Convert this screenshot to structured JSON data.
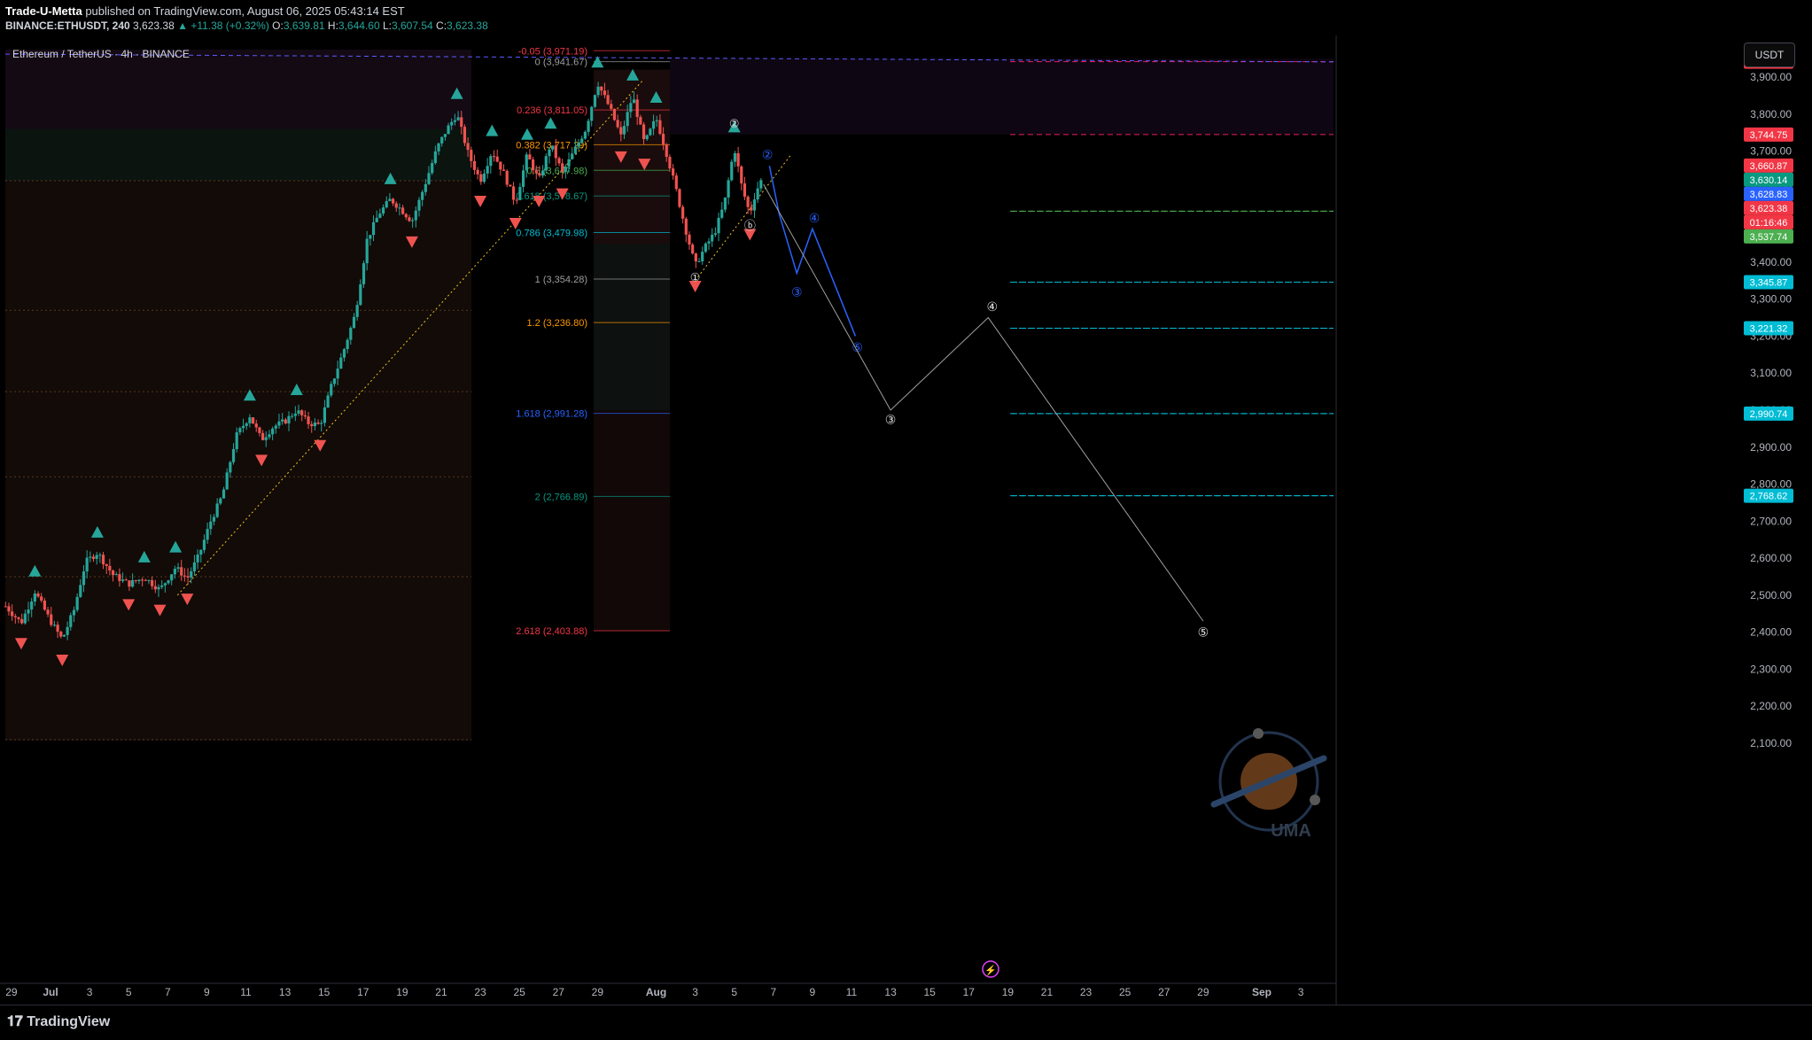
{
  "header": {
    "author": "Trade-U-Metta",
    "published": "published on TradingView.com, August 06, 2025 05:43:14 EST",
    "symbol": "BINANCE:ETHUSDT, 240",
    "last": "3,623.38",
    "change": "▲ +11.38 (+0.32%)",
    "open_label": "O:",
    "open": "3,639.81",
    "high_label": "H:",
    "high": "3,644.60",
    "low_label": "L:",
    "low": "3,607.54",
    "close_label": "C:",
    "close": "3,623.38"
  },
  "symbol_title": "Ethereum / TetherUS · 4h · BINANCE",
  "currency_button": "USDT",
  "footer": {
    "brand": "TradingView"
  },
  "colors": {
    "bull": "#26a69a",
    "bear": "#ef5350",
    "wave_blue": "#2962ff",
    "wave_white": "#e0e0e0",
    "level_cyan": "#00bcd4",
    "level_green": "#4caf50",
    "fib_orange": "#ff9800",
    "trendline": "#f0c419"
  },
  "chart_data": {
    "type": "candlestick",
    "y_axis": {
      "min": 2080,
      "max": 4000,
      "scale": "linear",
      "ticks": [
        "3,900.00",
        "3,800.00",
        "3,700.00",
        "3,600.00",
        "3,500.00",
        "3,400.00",
        "3,300.00",
        "3,200.00",
        "3,100.00",
        "3,000.00",
        "2,900.00",
        "2,800.00",
        "2,700.00",
        "2,600.00",
        "2,500.00",
        "2,400.00",
        "2,300.00",
        "2,200.00",
        "2,100.00"
      ],
      "tick_values": [
        3900,
        3800,
        3700,
        3600,
        3500,
        3400,
        3300,
        3200,
        3100,
        3000,
        2900,
        2800,
        2700,
        2600,
        2500,
        2400,
        2300,
        2200,
        2100
      ]
    },
    "x_axis": {
      "ticks": [
        "29",
        "Jul",
        "3",
        "5",
        "7",
        "9",
        "11",
        "13",
        "15",
        "17",
        "19",
        "21",
        "23",
        "25",
        "27",
        "29",
        "Aug",
        "3",
        "5",
        "7",
        "9",
        "11",
        "13",
        "15",
        "17",
        "19",
        "21",
        "23",
        "25",
        "27",
        "29",
        "Sep",
        "3"
      ],
      "tick_days": [
        -2,
        0,
        2,
        4,
        6,
        8,
        10,
        12,
        14,
        16,
        18,
        20,
        22,
        24,
        26,
        28,
        31,
        33,
        35,
        37,
        39,
        41,
        43,
        45,
        47,
        49,
        51,
        53,
        55,
        57,
        59,
        62,
        64
      ],
      "bold_ticks": [
        "Jul",
        "Aug",
        "Sep"
      ]
    },
    "price_path": [
      {
        "day": -2.3,
        "price": 2470
      },
      {
        "day": -1.5,
        "price": 2425
      },
      {
        "day": -0.8,
        "price": 2510
      },
      {
        "day": 0,
        "price": 2430
      },
      {
        "day": 0.6,
        "price": 2380
      },
      {
        "day": 1.2,
        "price": 2460
      },
      {
        "day": 1.8,
        "price": 2590
      },
      {
        "day": 2.4,
        "price": 2615
      },
      {
        "day": 3.2,
        "price": 2555
      },
      {
        "day": 4,
        "price": 2530
      },
      {
        "day": 4.8,
        "price": 2548
      },
      {
        "day": 5.6,
        "price": 2515
      },
      {
        "day": 6.4,
        "price": 2575
      },
      {
        "day": 7,
        "price": 2545
      },
      {
        "day": 7.6,
        "price": 2608
      },
      {
        "day": 8.2,
        "price": 2700
      },
      {
        "day": 8.8,
        "price": 2770
      },
      {
        "day": 9.5,
        "price": 2930
      },
      {
        "day": 10.2,
        "price": 2985
      },
      {
        "day": 10.8,
        "price": 2920
      },
      {
        "day": 11.4,
        "price": 2955
      },
      {
        "day": 12,
        "price": 2970
      },
      {
        "day": 12.6,
        "price": 3000
      },
      {
        "day": 13.2,
        "price": 2965
      },
      {
        "day": 13.8,
        "price": 2960
      },
      {
        "day": 14.4,
        "price": 3070
      },
      {
        "day": 15,
        "price": 3160
      },
      {
        "day": 15.6,
        "price": 3260
      },
      {
        "day": 16.2,
        "price": 3460
      },
      {
        "day": 16.8,
        "price": 3530
      },
      {
        "day": 17.4,
        "price": 3570
      },
      {
        "day": 17.9,
        "price": 3545
      },
      {
        "day": 18.5,
        "price": 3510
      },
      {
        "day": 19.2,
        "price": 3615
      },
      {
        "day": 19.8,
        "price": 3710
      },
      {
        "day": 20.3,
        "price": 3760
      },
      {
        "day": 20.8,
        "price": 3800
      },
      {
        "day": 21.4,
        "price": 3690
      },
      {
        "day": 22,
        "price": 3620
      },
      {
        "day": 22.6,
        "price": 3700
      },
      {
        "day": 23.2,
        "price": 3640
      },
      {
        "day": 23.8,
        "price": 3560
      },
      {
        "day": 24.4,
        "price": 3690
      },
      {
        "day": 25,
        "price": 3620
      },
      {
        "day": 25.6,
        "price": 3720
      },
      {
        "day": 26.2,
        "price": 3640
      },
      {
        "day": 26.8,
        "price": 3700
      },
      {
        "day": 27.4,
        "price": 3760
      },
      {
        "day": 28,
        "price": 3885
      },
      {
        "day": 28.6,
        "price": 3820
      },
      {
        "day": 29.2,
        "price": 3740
      },
      {
        "day": 29.8,
        "price": 3850
      },
      {
        "day": 30.4,
        "price": 3720
      },
      {
        "day": 31,
        "price": 3790
      },
      {
        "day": 31.5,
        "price": 3700
      },
      {
        "day": 32,
        "price": 3600
      },
      {
        "day": 32.5,
        "price": 3490
      },
      {
        "day": 33,
        "price": 3390
      },
      {
        "day": 33.5,
        "price": 3440
      },
      {
        "day": 34,
        "price": 3480
      },
      {
        "day": 34.5,
        "price": 3560
      },
      {
        "day": 35,
        "price": 3710
      },
      {
        "day": 35.4,
        "price": 3600
      },
      {
        "day": 35.8,
        "price": 3530
      },
      {
        "day": 36.1,
        "price": 3590
      },
      {
        "day": 36.4,
        "price": 3623
      }
    ],
    "price_labels": [
      {
        "text": "3,941.67",
        "price": 3941.67,
        "color": "#f23645"
      },
      {
        "text": "3,744.75",
        "price": 3744.75,
        "color": "#f23645"
      },
      {
        "text": "3,660.87",
        "price": 3660.87,
        "color": "#f23645"
      },
      {
        "text": "3,630.14",
        "price": 3630.14,
        "color": "#089981"
      },
      {
        "text": "3,628.83",
        "price": 3628.83,
        "color": "#2962ff"
      },
      {
        "text": "3,623.38",
        "price": 3623.38,
        "color": "#f23645"
      },
      {
        "text": "01:16:46",
        "price": 3600,
        "color": "#f23645"
      },
      {
        "text": "3,537.74",
        "price": 3537.74,
        "color": "#4caf50"
      },
      {
        "text": "3,345.87",
        "price": 3345.87,
        "color": "#00bcd4"
      },
      {
        "text": "3,221.32",
        "price": 3221.32,
        "color": "#00bcd4"
      },
      {
        "text": "2,990.74",
        "price": 2990.74,
        "color": "#00bcd4"
      },
      {
        "text": "2,768.62",
        "price": 2768.62,
        "color": "#00bcd4"
      }
    ],
    "horizontal_levels": [
      {
        "price": 3345.87,
        "color": "#00bcd4"
      },
      {
        "price": 3221.32,
        "color": "#00bcd4"
      },
      {
        "price": 2990.74,
        "color": "#00bcd4"
      },
      {
        "price": 2768.62,
        "color": "#00bcd4"
      },
      {
        "price": 3537.74,
        "color": "#4caf50"
      },
      {
        "price": 3744.75,
        "color": "#e91e63"
      },
      {
        "price": 3941.67,
        "color": "#e91e63"
      }
    ],
    "fibonacci": [
      {
        "ratio": "-0.05",
        "text": "-0.05 (3,971.19)",
        "price": 3971.19,
        "color": "#f23645"
      },
      {
        "ratio": "0",
        "text": "0 (3,941.67)",
        "price": 3941.67,
        "color": "#9e9e9e"
      },
      {
        "ratio": "0.236",
        "text": "0.236 (3,811.05)",
        "price": 3811.05,
        "color": "#f23645"
      },
      {
        "ratio": "0.382",
        "text": "0.382 (3,717.29)",
        "price": 3717.29,
        "color": "#ff9800"
      },
      {
        "ratio": "0.5",
        "text": "0.5 (3,647.98)",
        "price": 3647.98,
        "color": "#4caf50"
      },
      {
        "ratio": "0.618",
        "text": "0.618 (3,578.67)",
        "price": 3578.67,
        "color": "#089981"
      },
      {
        "ratio": "0.786",
        "text": "0.786 (3,479.98)",
        "price": 3479.98,
        "color": "#00bcd4"
      },
      {
        "ratio": "1",
        "text": "1 (3,354.28)",
        "price": 3354.28,
        "color": "#9e9e9e"
      },
      {
        "ratio": "1.2",
        "text": "1.2 (3,236.80)",
        "price": 3236.8,
        "color": "#ff9800"
      },
      {
        "ratio": "1.618",
        "text": "1.618 (2,991.28)",
        "price": 2991.28,
        "color": "#2962ff"
      },
      {
        "ratio": "2",
        "text": "2 (2,766.89)",
        "price": 2766.89,
        "color": "#089981"
      },
      {
        "ratio": "2.618",
        "text": "2.618 (2,403.88)",
        "price": 2403.88,
        "color": "#f23645"
      }
    ],
    "wave_projection_blue": {
      "points": [
        {
          "day": 36.8,
          "price": 3660
        },
        {
          "day": 37.3,
          "price": 3530
        },
        {
          "day": 38.2,
          "price": 3370
        },
        {
          "day": 39,
          "price": 3490
        },
        {
          "day": 41.2,
          "price": 3200
        }
      ],
      "labels": [
        {
          "text": "②",
          "day": 36.7,
          "price": 3690
        },
        {
          "text": "③",
          "day": 38.2,
          "price": 3320
        },
        {
          "text": "④",
          "day": 39.1,
          "price": 3520
        },
        {
          "text": "⑤",
          "day": 41.3,
          "price": 3170
        }
      ]
    },
    "wave_projection_white": {
      "points": [
        {
          "day": 36.5,
          "price": 3610
        },
        {
          "day": 43,
          "price": 3000
        },
        {
          "day": 48,
          "price": 3250
        },
        {
          "day": 59,
          "price": 2430
        }
      ],
      "labels": [
        {
          "text": "③",
          "day": 43,
          "price": 2975
        },
        {
          "text": "④",
          "day": 48.2,
          "price": 3280
        },
        {
          "text": "⑤",
          "day": 59,
          "price": 2400
        }
      ]
    },
    "past_wave_labels": [
      {
        "text": "①",
        "day": 33,
        "price": 3360
      },
      {
        "text": "②",
        "day": 35,
        "price": 3775
      },
      {
        "text": "ⓑ",
        "day": 35.8,
        "price": 3500
      }
    ],
    "trendlines": [
      {
        "from": {
          "day": 6.5,
          "price": 2500
        },
        "to": {
          "day": 30.3,
          "price": 3890
        }
      },
      {
        "from": {
          "day": 33,
          "price": 3350
        },
        "to": {
          "day": 37.9,
          "price": 3690
        }
      }
    ]
  }
}
